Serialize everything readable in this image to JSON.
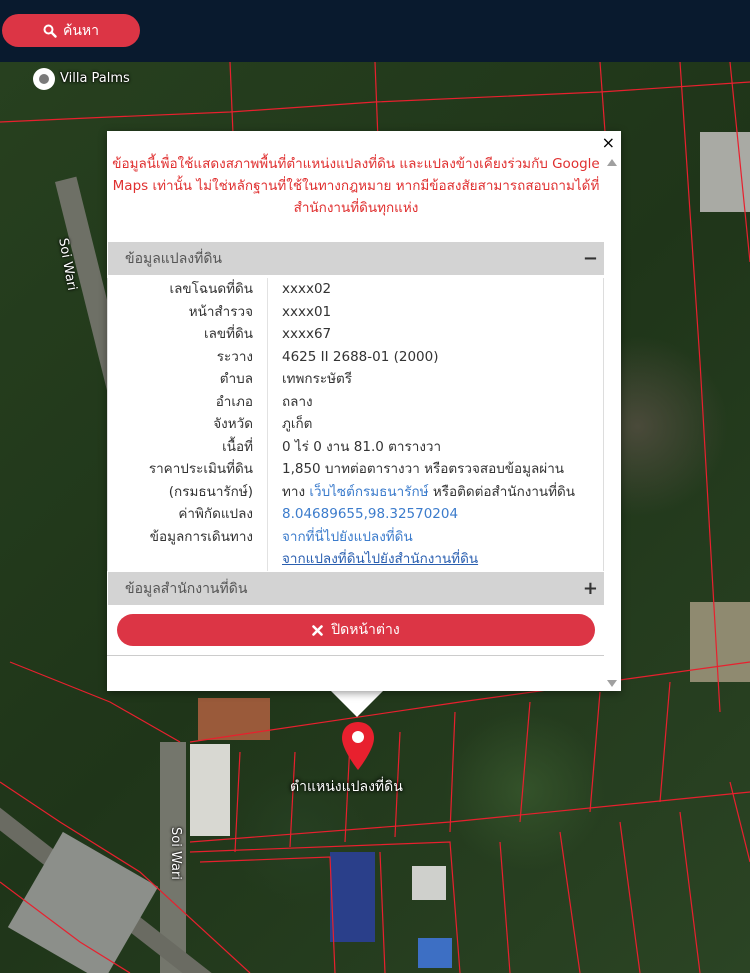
{
  "header": {
    "search_label": "ค้นหา",
    "search_icon": "search-icon"
  },
  "map": {
    "place_name": "Villa Palms",
    "road_name_1": "Soi Wari",
    "road_name_2": "Soi Wari",
    "marker_label": "ตำแหน่งแปลงที่ดิน",
    "marker_color": "#e8202e"
  },
  "popup": {
    "close_symbol": "×",
    "disclaimer": "ข้อมูลนี้เพื่อใช้แสดงสภาพพื้นที่ตำแหน่งแปลงที่ดิน และแปลงข้างเคียงร่วมกับ Google Maps เท่านั้น ไม่ใช่หลักฐานที่ใช้ในทางกฎหมาย หากมีข้อสงสัยสามารถสอบถามได้ที่สำนักงานที่ดินทุกแห่ง",
    "land_section": {
      "title": "ข้อมูลแปลงที่ดิน",
      "toggle": "−",
      "rows": [
        {
          "label": "เลขโฉนดที่ดิน",
          "value": "xxxx02"
        },
        {
          "label": "หน้าสำรวจ",
          "value": "xxxx01"
        },
        {
          "label": "เลขที่ดิน",
          "value": "xxxx67"
        },
        {
          "label": "ระวาง",
          "value": "4625 II 2688-01 (2000)"
        },
        {
          "label": "ตำบล",
          "value": "เทพกระษัตรี"
        },
        {
          "label": "อำเภอ",
          "value": "ถลาง"
        },
        {
          "label": "จังหวัด",
          "value": "ภูเก็ต"
        },
        {
          "label": "เนื้อที่",
          "value": "0 ไร่ 0 งาน 81.0 ตารางวา"
        }
      ],
      "price_label_1": "ราคาประเมินที่ดิน",
      "price_label_2": "(กรมธนารักษ์)",
      "price_value_1": "1,850 บาทต่อตารางวา หรือตรวจสอบข้อมูลผ่าน",
      "price_value_2_pre": "ทาง ",
      "price_value_2_link": "เว็บไซต์กรมธนารักษ์",
      "price_value_2_post": " หรือติดต่อสำนักงานที่ดิน",
      "coord_label": "ค่าพิกัดแปลง",
      "coord_value": "8.04689655,98.32570204",
      "route_label": "ข้อมูลการเดินทาง",
      "route_link_1": "จากที่นี่ไปยังแปลงที่ดิน",
      "route_link_2": "จากแปลงที่ดินไปยังสำนักงานที่ดิน"
    },
    "office_section": {
      "title": "ข้อมูลสำนักงานที่ดิน",
      "toggle": "+"
    },
    "close_button_label": "ปิดหน้าต่าง",
    "close_button_icon": "times-icon"
  }
}
